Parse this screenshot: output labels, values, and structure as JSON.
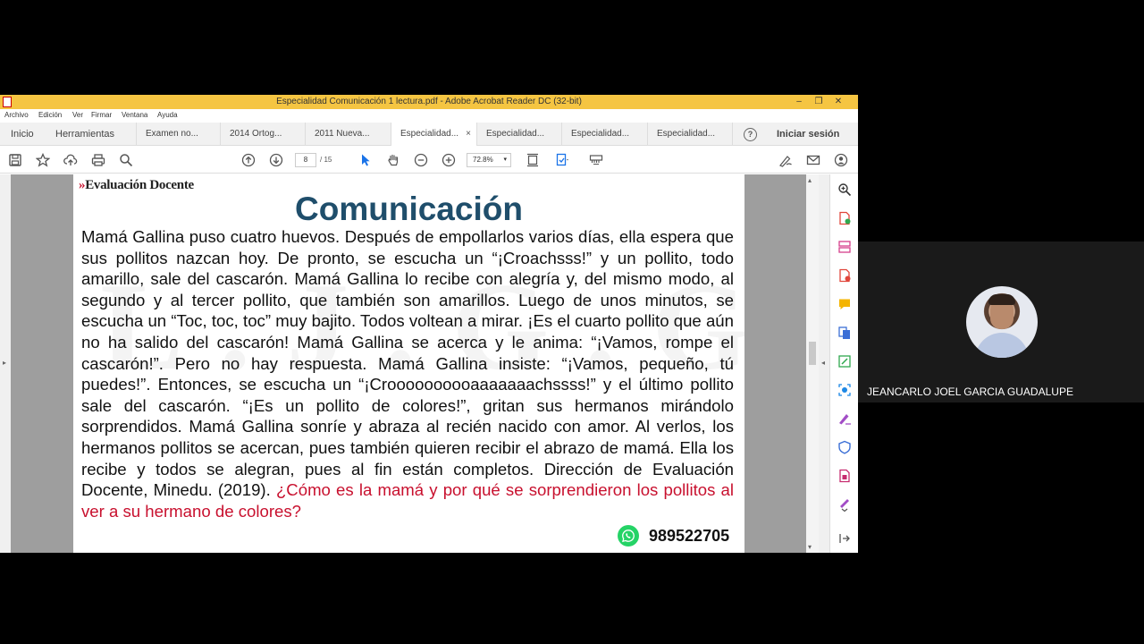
{
  "window": {
    "title": "Especialidad Comunicación 1 lectura.pdf - Adobe Acrobat Reader DC (32-bit)",
    "minimize": "–",
    "restore": "❐",
    "close": "✕"
  },
  "menu": [
    "Archivo",
    "Edición",
    "Ver",
    "Firmar",
    "Ventana",
    "Ayuda"
  ],
  "tabs": {
    "home": "Inicio",
    "tools": "Herramientas",
    "docs": [
      "Examen no...",
      "2014 Ortog...",
      "2011 Nueva...",
      "Especialidad...",
      "Especialidad...",
      "Especialidad...",
      "Especialidad..."
    ],
    "active_close": "×",
    "help": "?",
    "signin": "Iniciar sesión"
  },
  "toolbar": {
    "page_current": "8",
    "page_total": "/ 15",
    "zoom": "72.8%"
  },
  "document": {
    "brand": "Evaluación Docente",
    "brand_mark": "»",
    "watermark": "L.J.G.G.",
    "title": "Comunicación",
    "body": "Mamá Gallina puso cuatro huevos. Después de empollarlos varios días, ella espera que sus pollitos nazcan hoy. De pronto, se escucha un “¡Croachsss!” y un pollito, todo amarillo, sale del cascarón. Mamá Gallina lo recibe con alegría y, del mismo modo, al segundo y al tercer pollito, que también son amarillos. Luego de unos minutos, se escucha un “Toc, toc, toc” muy bajito. Todos voltean a mirar. ¡Es el cuarto pollito que aún no ha salido del cascarón! Mamá Gallina se acerca y le anima: “¡Vamos, rompe el cascarón!”. Pero no hay respuesta. Mamá Gallina insiste: “¡Vamos, pequeño, tú puedes!”. Entonces, se escucha un “¡Croooooooooaaaaaaachssss!” y el último pollito sale del cascarón. “¡Es un pollito de colores!”, gritan sus hermanos mirándolo sorprendidos. Mamá Gallina sonríe y abraza al recién nacido con amor. Al verlos, los hermanos pollitos se acercan, pues también quieren recibir el abrazo de mamá. Ella los recibe y todos se alegran, pues al fin están completos. Dirección de Evaluación Docente, Minedu. (2019). ",
    "question": "¿Cómo es la mamá y por qué se sorprendieron los pollitos al ver a su hermano de colores?",
    "phone": "989522705"
  },
  "participant": {
    "name": "JEANCARLO JOEL GARCIA GUADALUPE"
  },
  "colors": {
    "titlebar": "#f5c542",
    "title_blue": "#1f4e6b",
    "question_red": "#c8102e",
    "whatsapp": "#25d366"
  }
}
